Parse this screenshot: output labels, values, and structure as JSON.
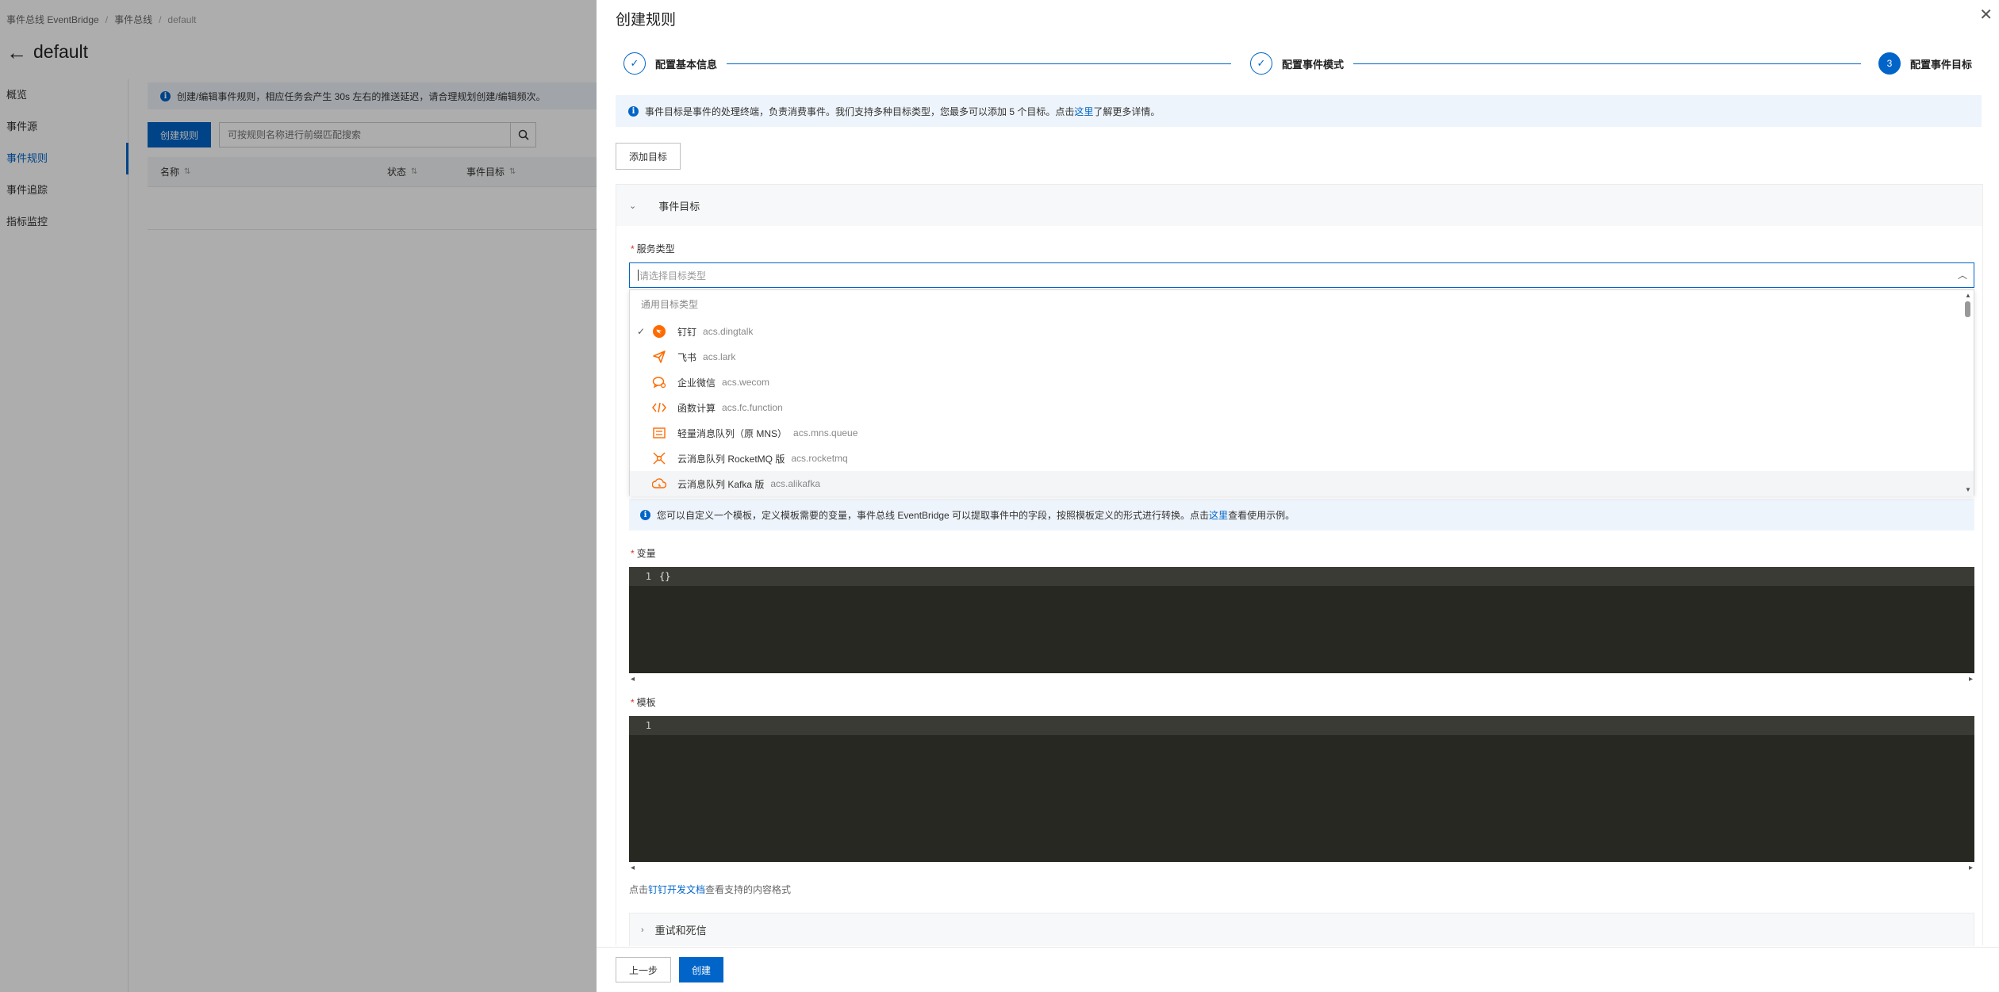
{
  "background": {
    "breadcrumb": [
      "事件总线 EventBridge",
      "事件总线",
      "default"
    ],
    "title": "default",
    "nav": [
      "概览",
      "事件源",
      "事件规则",
      "事件追踪",
      "指标监控"
    ],
    "active_nav": "事件规则",
    "notice": "创建/编辑事件规则，相应任务会产生 30s 左右的推送延迟，请合理规划创建/编辑频次。",
    "create_button": "创建规则",
    "search_placeholder": "可按规则名称进行前缀匹配搜索",
    "table_columns": [
      "名称",
      "状态",
      "事件目标"
    ]
  },
  "drawer": {
    "title": "创建规则",
    "steps": [
      {
        "label": "配置基本信息",
        "state": "done"
      },
      {
        "label": "配置事件模式",
        "state": "done"
      },
      {
        "label": "配置事件目标",
        "state": "current",
        "number": "3"
      }
    ],
    "notice": {
      "before": "事件目标是事件的处理终端，负责消费事件。我们支持多种目标类型，您最多可以添加 5 个目标。点击",
      "link": "这里",
      "after": "了解更多详情。"
    },
    "add_target_button": "添加目标",
    "panel_title": "事件目标",
    "service_type_label": "服务类型",
    "service_type_placeholder": "请选择目标类型",
    "dropdown": {
      "group": "通用目标类型",
      "items": [
        {
          "name": "钉钉",
          "code": "acs.dingtalk",
          "icon": "dingtalk-icon",
          "checked": true
        },
        {
          "name": "飞书",
          "code": "acs.lark",
          "icon": "lark-icon",
          "checked": false
        },
        {
          "name": "企业微信",
          "code": "acs.wecom",
          "icon": "wecom-icon",
          "checked": false
        },
        {
          "name": "函数计算",
          "code": "acs.fc.function",
          "icon": "function-icon",
          "checked": false
        },
        {
          "name": "轻量消息队列（原 MNS）",
          "code": "acs.mns.queue",
          "icon": "mns-queue-icon",
          "checked": false
        },
        {
          "name": "云消息队列 RocketMQ 版",
          "code": "acs.rocketmq",
          "icon": "rocketmq-icon",
          "checked": false
        },
        {
          "name": "云消息队列 Kafka 版",
          "code": "acs.alikafka",
          "icon": "kafka-icon",
          "checked": false
        }
      ]
    },
    "template_notice": {
      "before": "您可以自定义一个模板，定义模板需要的变量，事件总线 EventBridge 可以提取事件中的字段，按照模板定义的形式进行转换。点击",
      "link": "这里",
      "after": "查看使用示例。"
    },
    "variables_label": "变量",
    "variables_editor": {
      "line_number": "1",
      "content": "{}"
    },
    "template_label": "模板",
    "template_editor": {
      "line_number": "1",
      "content": ""
    },
    "doc_hint": {
      "before": "点击",
      "link": "钉钉开发文档",
      "after": "查看支持的内容格式"
    },
    "retry_section": "重试和死信",
    "prev_button": "上一步",
    "create_button": "创建"
  },
  "colors": {
    "primary": "#0064c8",
    "icon_orange": "#ff6a00",
    "editor_bg": "#272822",
    "notice_bg": "#eef4fb"
  }
}
